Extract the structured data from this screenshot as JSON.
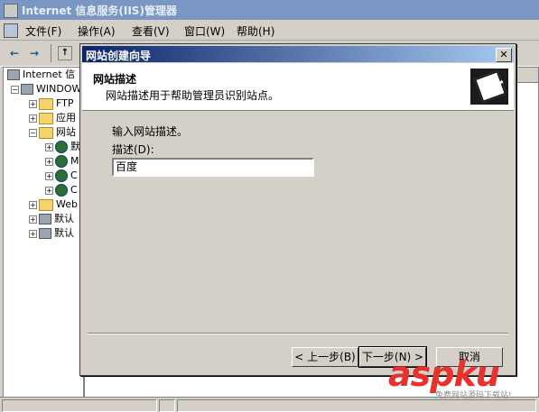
{
  "window": {
    "title": "Internet 信息服务(IIS)管理器"
  },
  "menu": {
    "items": [
      "文件(F)",
      "操作(A)",
      "查看(V)",
      "窗口(W)",
      "帮助(H)"
    ]
  },
  "tree": {
    "items": [
      {
        "label": "Internet 信"
      },
      {
        "label": "WINDOWS"
      },
      {
        "label": "FTP"
      },
      {
        "label": "应用"
      },
      {
        "label": "网站"
      },
      {
        "label": "默"
      },
      {
        "label": "M"
      },
      {
        "label": "C"
      },
      {
        "label": "C"
      },
      {
        "label": "Web"
      },
      {
        "label": "默认"
      },
      {
        "label": "默认"
      }
    ]
  },
  "dialog": {
    "title": "网站创建向导",
    "header_title": "网站描述",
    "header_subtitle": "网站描述用于帮助管理员识别站点。",
    "instruction": "输入网站描述。",
    "field_label": "描述(D):",
    "field_value": "百度",
    "buttons": {
      "back": "< 上一步(B)",
      "next": "下一步(N) >",
      "cancel": "取消"
    }
  },
  "watermark": {
    "brand": "aspku",
    "sub": "免费网站源码下载站!"
  }
}
